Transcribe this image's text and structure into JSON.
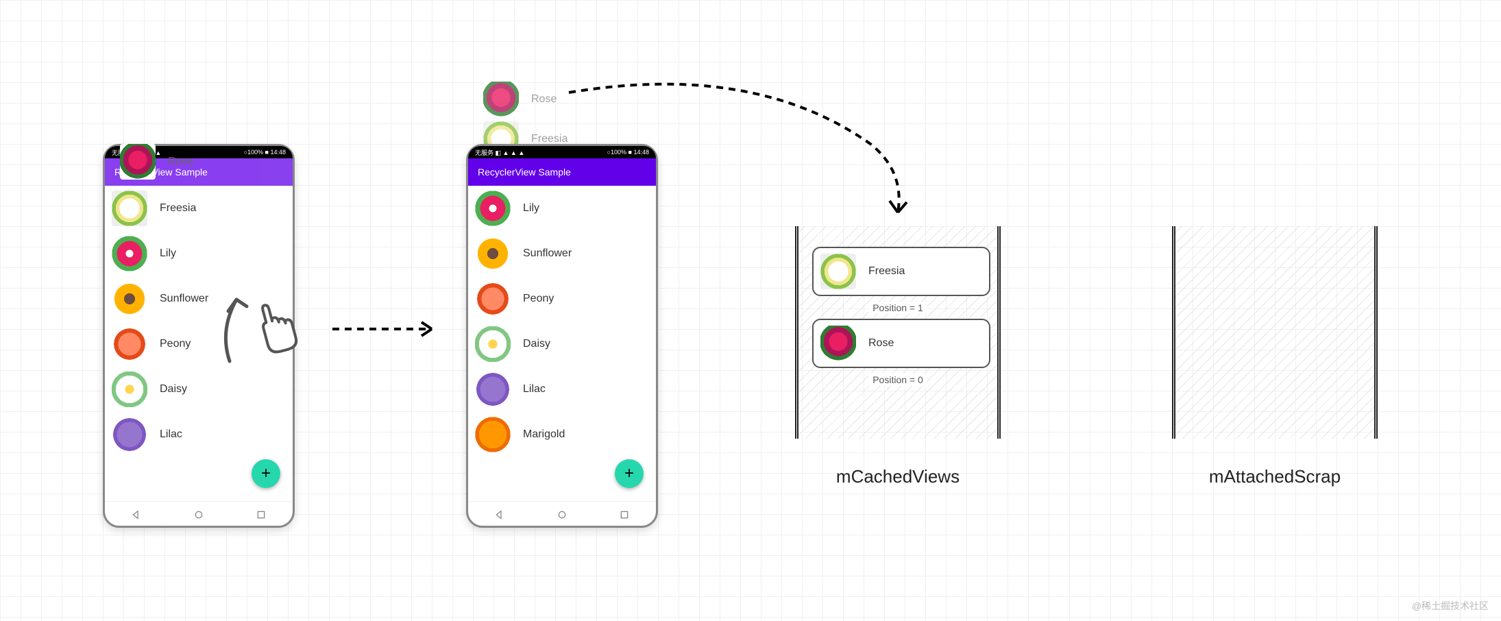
{
  "app_title": "RecyclerView Sample",
  "status": {
    "left": "无服务 ◧ ▲ ▲ ▲",
    "right": "○100% ■ 14:48",
    "right1": "○100% ■ 14:48"
  },
  "phone1_items": [
    {
      "name": "Freesia",
      "cls": "freesia"
    },
    {
      "name": "Lily",
      "cls": "lily"
    },
    {
      "name": "Sunflower",
      "cls": "sunflower"
    },
    {
      "name": "Peony",
      "cls": "peony"
    },
    {
      "name": "Daisy",
      "cls": "daisy"
    },
    {
      "name": "Lilac",
      "cls": "lilac"
    }
  ],
  "phone1_overflow": {
    "name": "Rose",
    "cls": "rose"
  },
  "phone2_items": [
    {
      "name": "Lily",
      "cls": "lily"
    },
    {
      "name": "Sunflower",
      "cls": "sunflower"
    },
    {
      "name": "Peony",
      "cls": "peony"
    },
    {
      "name": "Daisy",
      "cls": "daisy"
    },
    {
      "name": "Lilac",
      "cls": "lilac"
    },
    {
      "name": "Marigold",
      "cls": "marigold"
    }
  ],
  "scrolled_off": [
    {
      "name": "Rose",
      "cls": "rose"
    },
    {
      "name": "Freesia",
      "cls": "freesia"
    }
  ],
  "cached_views": [
    {
      "name": "Freesia",
      "cls": "freesia",
      "position_label": "Position = 1"
    },
    {
      "name": "Rose",
      "cls": "rose",
      "position_label": "Position = 0"
    }
  ],
  "cache_titles": {
    "a": "mCachedViews",
    "b": "mAttachedScrap"
  },
  "fab_label": "+",
  "watermark": "@稀土掘技术社区"
}
